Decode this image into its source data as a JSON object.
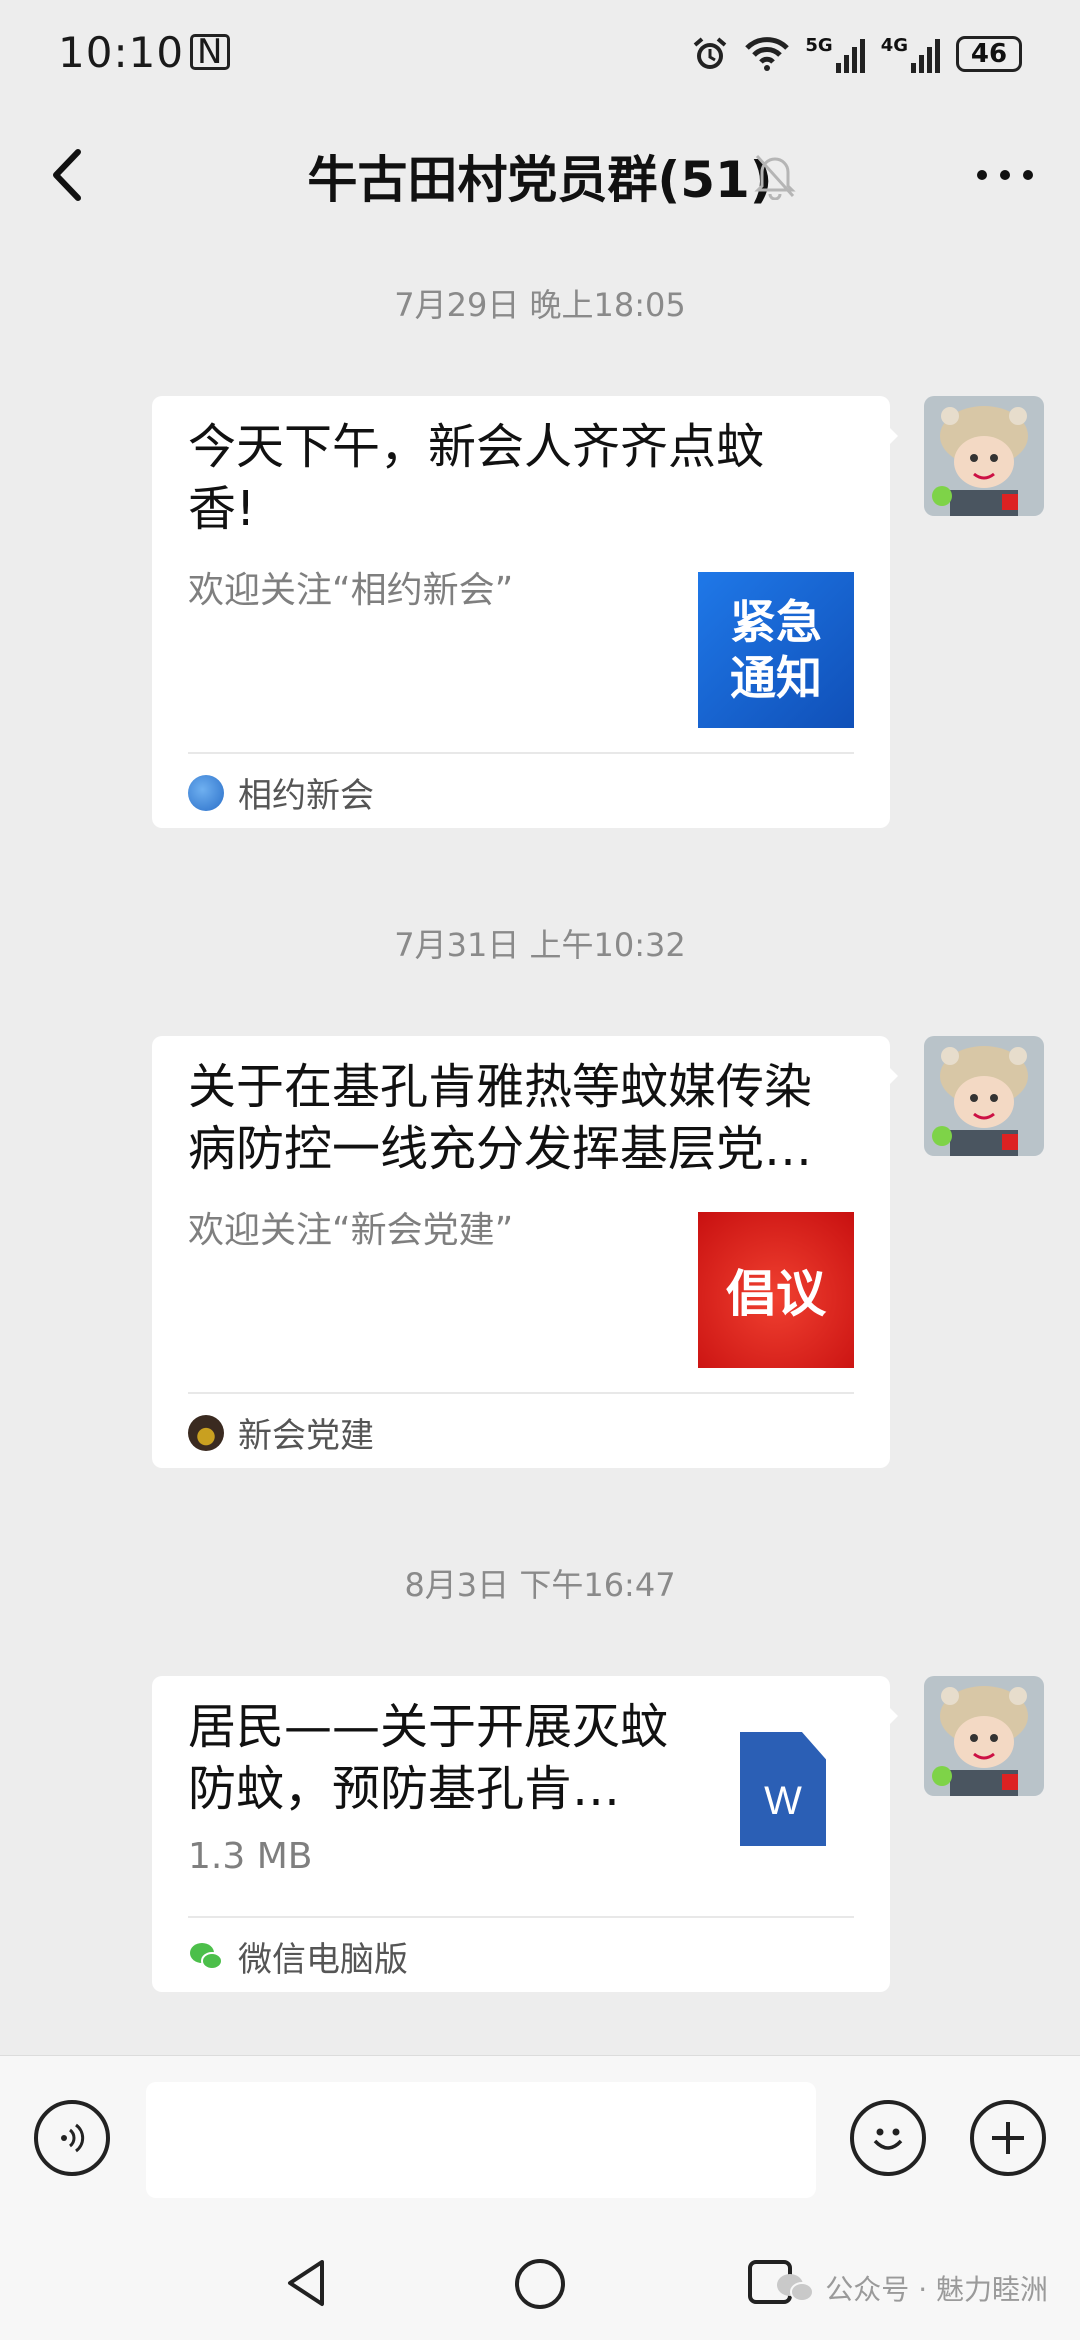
{
  "status_bar": {
    "time": "10:10",
    "nfc": "N",
    "net1": "5G",
    "net2": "4G",
    "battery": "46"
  },
  "header": {
    "title": "牛古田村党员群(51)"
  },
  "messages": [
    {
      "timestamp": "7月29日 晚上18:05",
      "title": "今天下午，新会人齐齐点蚊香!",
      "desc": "欢迎关注“相约新会”",
      "thumb_lines": [
        "紧急",
        "通知"
      ],
      "thumb_color": "#1a66d6",
      "source": "相约新会"
    },
    {
      "timestamp": "7月31日 上午10:32",
      "title": "关于在基孔肯雅热等蚊媒传染病防控一线充分发挥基层党…",
      "desc": "欢迎关注“新会党建”",
      "thumb_lines": [
        "倡议"
      ],
      "thumb_color": "#dc2020",
      "source": "新会党建"
    },
    {
      "timestamp": "8月3日 下午16:47",
      "title": "居民——关于开展灭蚊防蚊，预防基孔肯…",
      "size": "1.3 MB",
      "file_icon_letter": "W",
      "source": "微信电脑版"
    }
  ],
  "watermark": "公众号 · 魅力睦洲"
}
